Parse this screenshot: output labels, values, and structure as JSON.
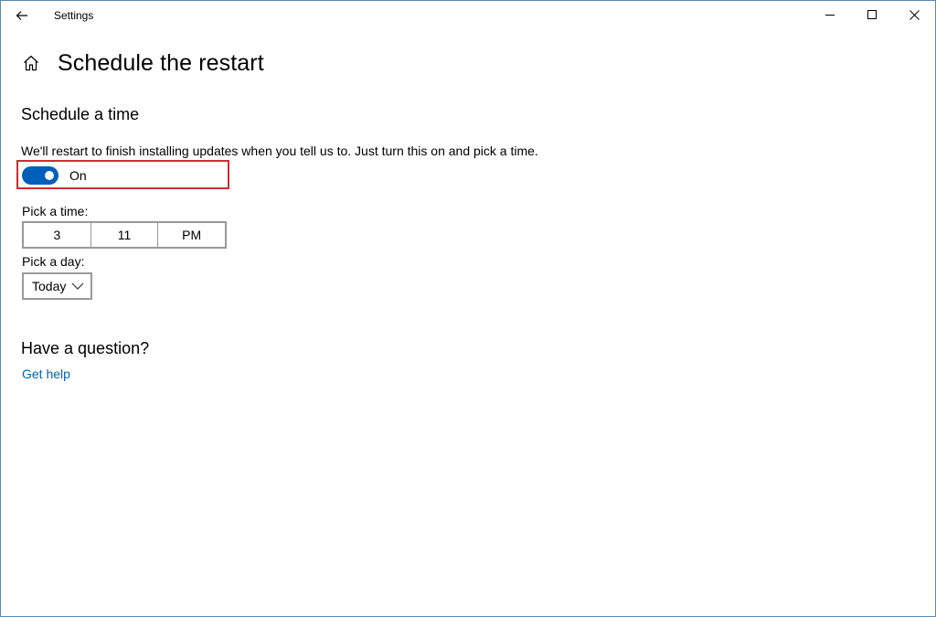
{
  "window": {
    "title": "Settings"
  },
  "page": {
    "title": "Schedule the restart"
  },
  "schedule": {
    "section_title": "Schedule a time",
    "description": "We'll restart to finish installing updates when you tell us to. Just turn this on and pick a time.",
    "toggle_state": "On",
    "time_label": "Pick a time:",
    "time": {
      "hour": "3",
      "minute": "11",
      "period": "PM"
    },
    "day_label": "Pick a day:",
    "day_value": "Today"
  },
  "help": {
    "title": "Have a question?",
    "link": "Get help"
  },
  "colors": {
    "accent": "#005fb8",
    "link": "#0063b1",
    "highlight": "#d12b33"
  },
  "icons": {
    "back": "back-arrow-icon",
    "home": "home-icon",
    "minimize": "minimize-icon",
    "maximize": "maximize-icon",
    "close": "close-icon",
    "dropdown": "chevron-down-icon"
  }
}
